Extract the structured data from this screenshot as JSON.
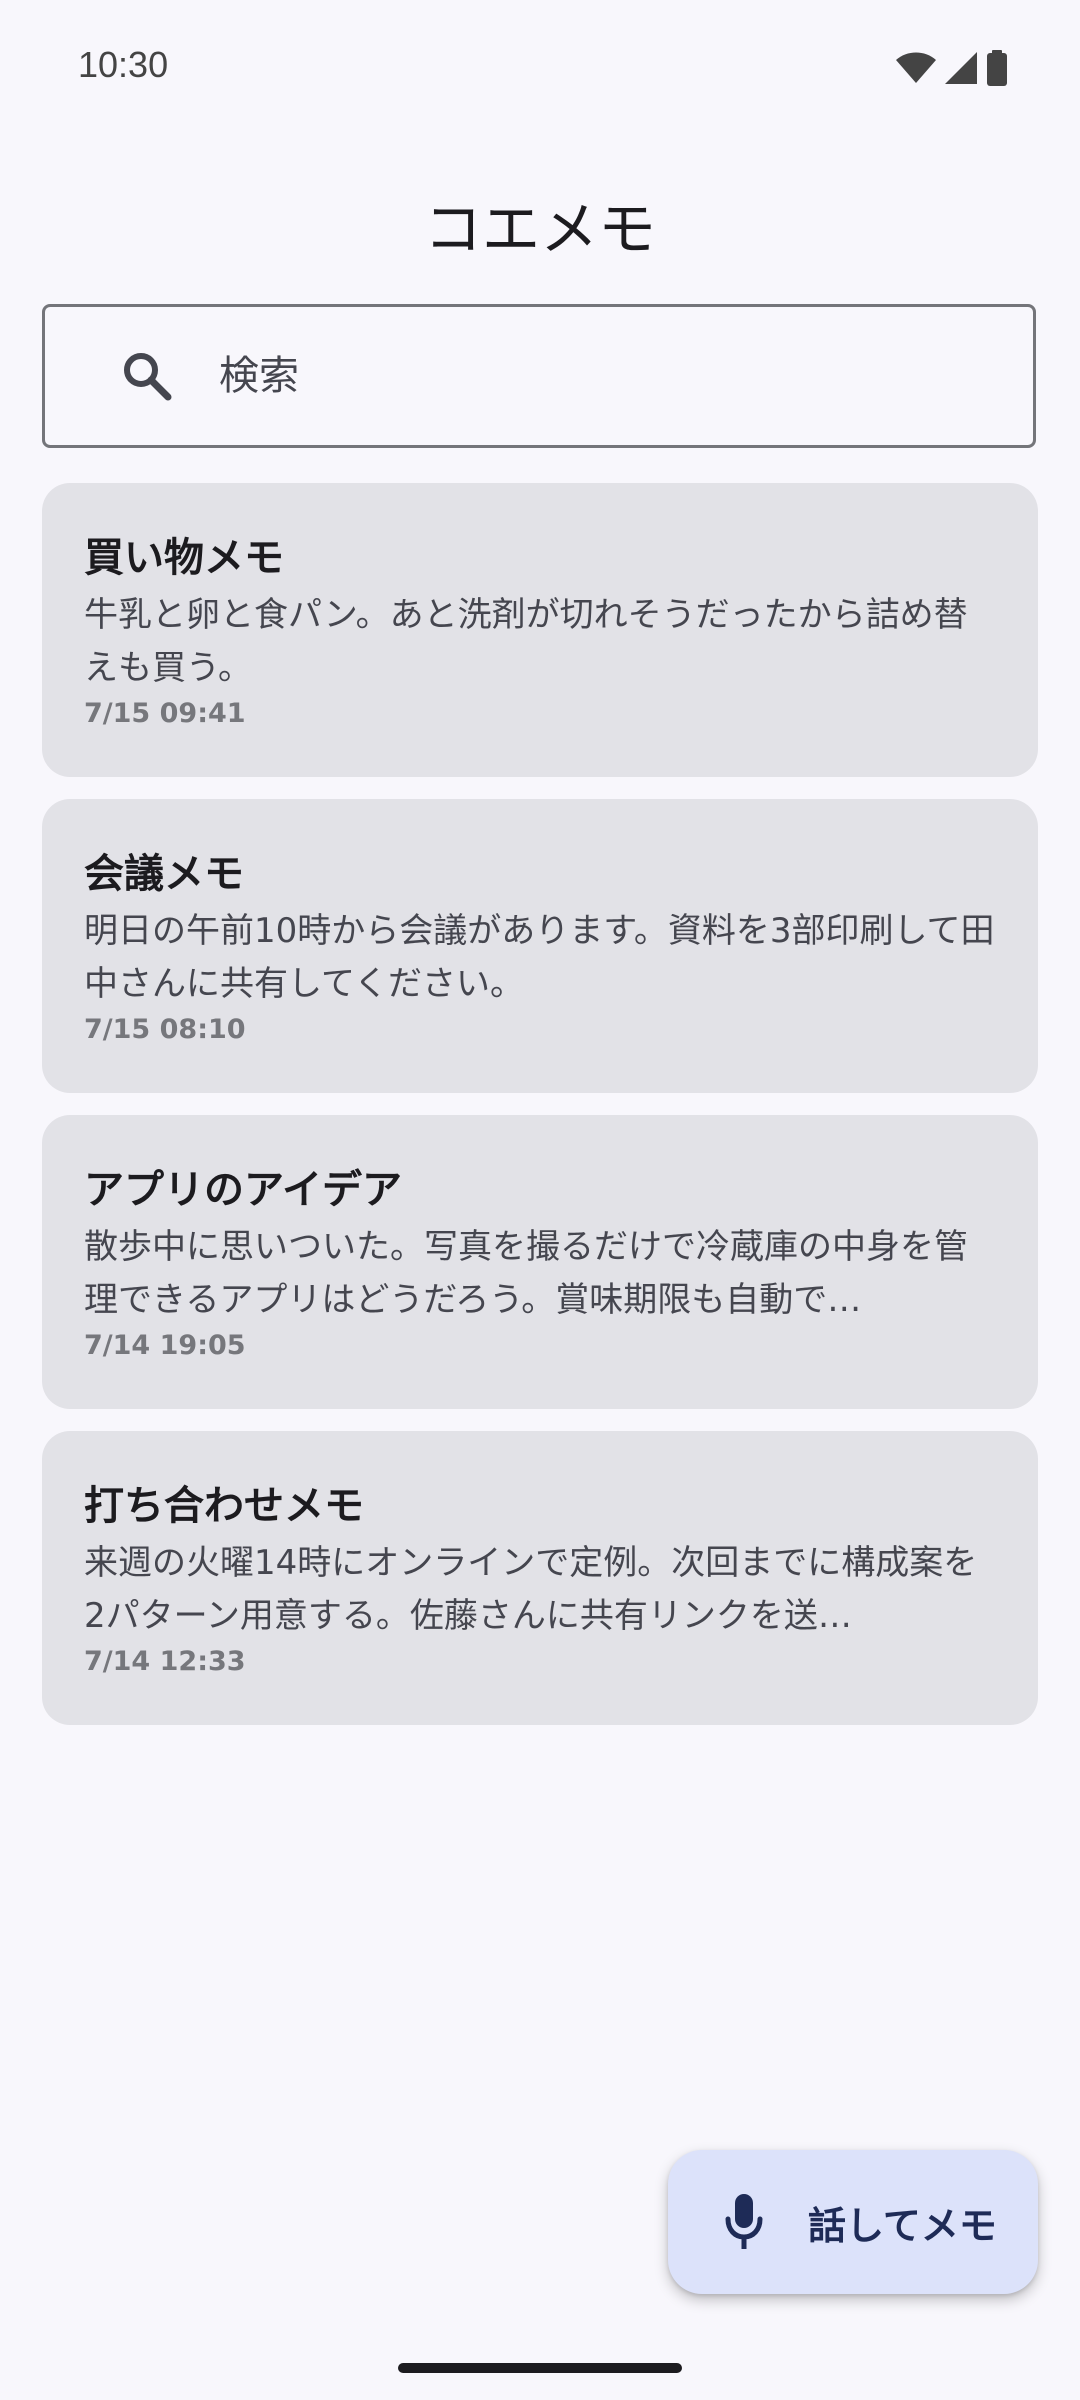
{
  "status_bar": {
    "time": "10:30",
    "icons": [
      "wifi-icon",
      "cellular-signal-icon",
      "battery-icon"
    ]
  },
  "app": {
    "title": "コエメモ"
  },
  "search": {
    "placeholder": "検索",
    "value": "",
    "icon": "search-icon"
  },
  "memos": [
    {
      "title": "買い物メモ",
      "body": "牛乳と卵と食パン。あと洗剤が切れそうだったから詰め替えも買う。",
      "date": "7/15 09:41"
    },
    {
      "title": "会議メモ",
      "body": "明日の午前10時から会議があります。資料を3部印刷して田中さんに共有してください。",
      "date": "7/15 08:10"
    },
    {
      "title": "アプリのアイデア",
      "body": "散歩中に思いついた。写真を撮るだけで冷蔵庫の中身を管理できるアプリはどうだろう。賞味期限も自動で…",
      "date": "7/14 19:05"
    },
    {
      "title": "打ち合わせメモ",
      "body": "来週の火曜14時にオンラインで定例。次回までに構成案を2パターン用意する。佐藤さんに共有リンクを送…",
      "date": "7/14 12:33"
    }
  ],
  "fab": {
    "label": "話してメモ",
    "icon": "microphone-icon"
  },
  "colors": {
    "background": "#f8f7fc",
    "card": "#e2e2e7",
    "fab_background": "#dce2fa",
    "fab_text": "#1e2b57"
  }
}
